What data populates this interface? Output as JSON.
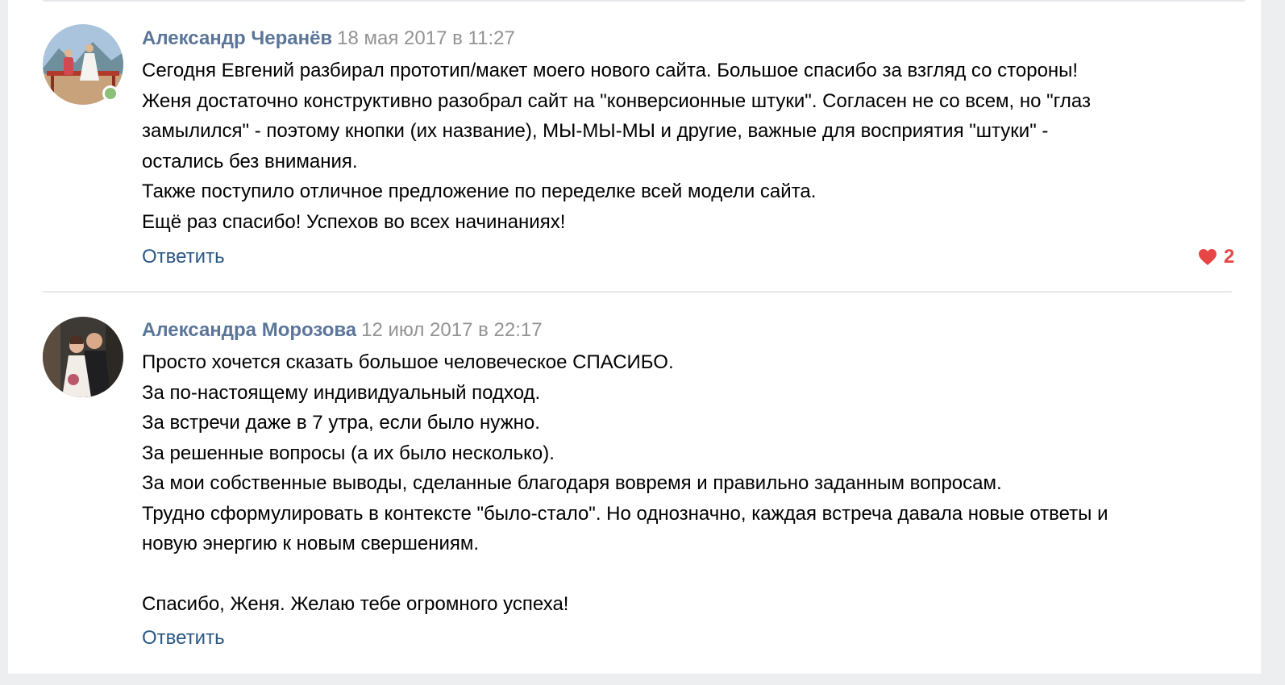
{
  "comments": [
    {
      "author": "Александр Черанёв",
      "date": "18 мая 2017 в 11:27",
      "online": true,
      "lines": [
        "Сегодня Евгений разбирал прототип/макет моего нового сайта. Большое спасибо за взгляд со стороны!",
        "Женя достаточно конструктивно разобрал сайт на \"конверсионные штуки\". Согласен не со всем, но \"глаз",
        "замылился\" - поэтому кнопки (их название), МЫ-МЫ-МЫ и другие, важные для восприятия \"штуки\" -",
        "остались без внимания.",
        "Также поступило отличное предложение по переделке всей модели сайта.",
        "Ещё раз спасибо! Успехов во всех начинаниях!"
      ],
      "reply_label": "Ответить",
      "likes": "2",
      "like_icon": "heart-icon"
    },
    {
      "author": "Александра Морозова",
      "date": "12 июл 2017 в 22:17",
      "lines": [
        "Просто хочется сказать большое человеческое СПАСИБО.",
        "За по-настоящему индивидуальный подход.",
        "За встречи даже в 7 утра, если было нужно.",
        "За решенные вопросы (а их было несколько).",
        "За мои собственные выводы, сделанные благодаря вовремя и правильно заданным вопросам.",
        "Трудно сформулировать в контексте \"было-стало\". Но однозначно, каждая встреча давала новые ответы и",
        "новую энергию к новым свершениям.",
        "",
        "Спасибо, Женя. Желаю тебе огромного успеха!"
      ],
      "reply_label": "Ответить"
    }
  ],
  "colors": {
    "author": "#5b7599",
    "date": "#939393",
    "link": "#2a5885",
    "like": "#e64646",
    "online": "#8ac176"
  }
}
